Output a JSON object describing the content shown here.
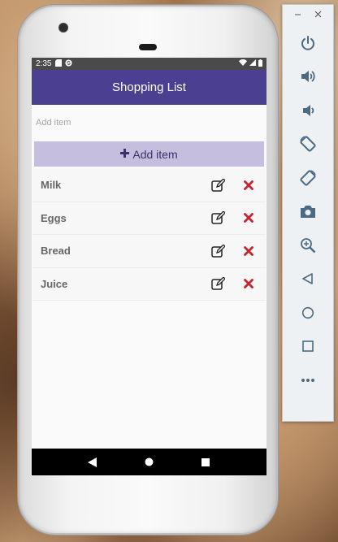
{
  "status_bar": {
    "time": "2:35"
  },
  "app_bar": {
    "title": "Shopping List"
  },
  "add_form": {
    "placeholder": "Add item",
    "value": "",
    "button_label": "Add item"
  },
  "items": [
    {
      "name": "Milk"
    },
    {
      "name": "Eggs"
    },
    {
      "name": "Bread"
    },
    {
      "name": "Juice"
    }
  ],
  "colors": {
    "app_bar": "#4b3f91",
    "add_button": "#c6bedf",
    "delete_icon": "#c4262e",
    "status_bar": "#4a4a4a"
  },
  "emulator_panel": {
    "window_controls": [
      "minimize-icon",
      "close-icon"
    ],
    "buttons": [
      "power-icon",
      "volume-up-icon",
      "volume-down-icon",
      "rotate-left-icon",
      "rotate-right-icon",
      "camera-icon",
      "zoom-icon",
      "back-icon",
      "home-icon",
      "overview-icon",
      "more-icon"
    ]
  }
}
